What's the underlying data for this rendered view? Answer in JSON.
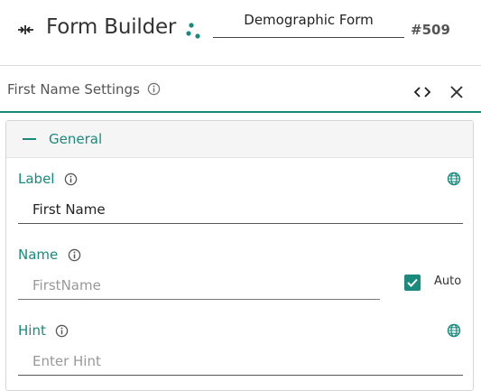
{
  "header": {
    "app_title": "Form Builder",
    "form_name": "Demographic Form",
    "form_id": "#509",
    "icons": [
      "collapse-icon",
      "dots-icon"
    ]
  },
  "panel": {
    "title": "First Name Settings",
    "icons": [
      "info-icon",
      "code-icon",
      "close-icon"
    ]
  },
  "section": {
    "label": "General",
    "expanded": true
  },
  "fields": {
    "label": {
      "label": "Label",
      "value": "First Name"
    },
    "name": {
      "label": "Name",
      "placeholder": "FirstName",
      "auto_checked": true,
      "auto_label": "Auto"
    },
    "hint": {
      "label": "Hint",
      "placeholder": "Enter Hint"
    }
  },
  "colors": {
    "accent": "#1a8a7d",
    "text": "#333333",
    "muted": "#999999"
  }
}
